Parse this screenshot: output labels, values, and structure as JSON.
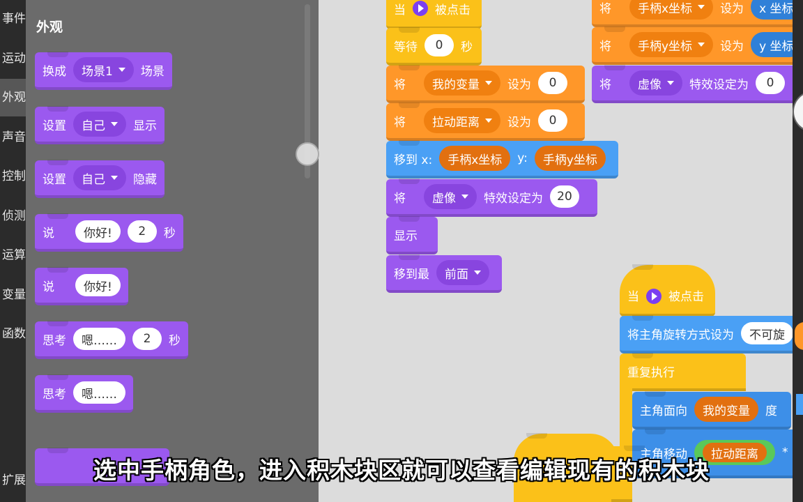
{
  "categories": [
    {
      "label": "事件",
      "active": false
    },
    {
      "label": "运动",
      "active": false
    },
    {
      "label": "外观",
      "active": true
    },
    {
      "label": "声音",
      "active": false
    },
    {
      "label": "控制",
      "active": false
    },
    {
      "label": "侦测",
      "active": false
    },
    {
      "label": "运算",
      "active": false
    },
    {
      "label": "变量",
      "active": false
    },
    {
      "label": "函数",
      "active": false
    },
    {
      "label": "扩展",
      "active": false
    }
  ],
  "palette": {
    "title": "外观",
    "blocks": [
      {
        "kw1": "换成",
        "dropdown": "场景1",
        "kw2": "场景"
      },
      {
        "kw1": "设置",
        "dropdown": "自己",
        "kw2": "显示"
      },
      {
        "kw1": "设置",
        "dropdown": "自己",
        "kw2": "隐藏"
      },
      {
        "kw1": "说",
        "text": "你好!",
        "num": "2",
        "kw2": "秒"
      },
      {
        "kw1": "说",
        "text": "你好!"
      },
      {
        "kw1": "思考",
        "text": "嗯……",
        "num": "2",
        "kw2": "秒"
      },
      {
        "kw1": "思考",
        "text": "嗯……"
      }
    ]
  },
  "script1": {
    "hat_when": "当",
    "hat_clicked": "被点击",
    "wait": {
      "label": "等待",
      "value": "0",
      "unit": "秒"
    },
    "set_var": {
      "kw": "将",
      "var": "我的变量",
      "to": "设为",
      "value": "0"
    },
    "set_drag": {
      "kw": "将",
      "var": "拉动距离",
      "to": "设为",
      "value": "0"
    },
    "goto": {
      "label_x": "移到 x:",
      "x": "手柄x坐标",
      "label_y": "y:",
      "y": "手柄y坐标"
    },
    "effect": {
      "kw": "将",
      "effect": "虚像",
      "label": "特效设定为",
      "value": "20"
    },
    "show": "显示",
    "front": {
      "label": "移到最",
      "layer": "前面"
    }
  },
  "script2": {
    "set_x": {
      "kw": "将",
      "var": "手柄x坐标",
      "to": "设为",
      "value": "x 坐标"
    },
    "set_y": {
      "kw": "将",
      "var": "手柄y坐标",
      "to": "设为",
      "value": "y 坐标"
    },
    "effect": {
      "kw": "将",
      "effect": "虚像",
      "label": "特效设定为",
      "value": "0"
    }
  },
  "script3": {
    "hat_when": "当",
    "hat_clicked": "被点击",
    "rotation": {
      "label": "将主角旋转方式设为",
      "value": "不可旋"
    },
    "repeat": "重复执行",
    "point": {
      "label": "主角面向",
      "var": "我的变量",
      "unit": "度"
    },
    "move": {
      "label": "主角移动",
      "var": "拉动距离",
      "op": "*"
    }
  },
  "caption": "选中手柄角色，进入积木块区就可以查看编辑现有的积木块",
  "colors": {
    "looks": "#9b59ef",
    "variables": "#ff9729",
    "events": "#fbc119",
    "motion": "#4aa0f5"
  }
}
